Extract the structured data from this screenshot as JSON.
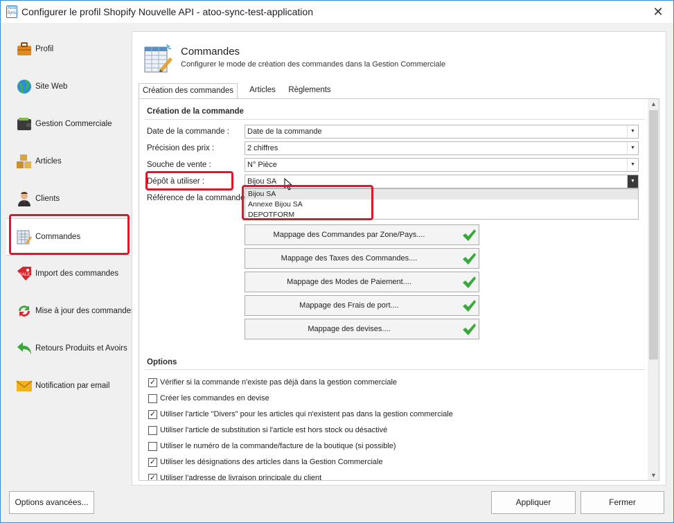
{
  "window": {
    "title": "Configurer le profil Shopify Nouvelle API - atoo-sync-test-application",
    "app_icon_text": "Atoo Sync",
    "close_glyph": "✕"
  },
  "sidebar": {
    "items": [
      {
        "label": "Profil",
        "icon": "briefcase-icon"
      },
      {
        "label": "Site Web",
        "icon": "globe-icon"
      },
      {
        "label": "Gestion Commerciale",
        "icon": "wallet-icon"
      },
      {
        "label": "Articles",
        "icon": "boxes-icon"
      },
      {
        "label": "Clients",
        "icon": "user-icon"
      },
      {
        "label": "Commandes",
        "icon": "order-sheet-icon"
      },
      {
        "label": "Import des commandes",
        "icon": "sale-tag-icon"
      },
      {
        "label": "Mise à jour des commandes",
        "icon": "refresh-arrows-icon"
      },
      {
        "label": "Retours Produits et Avoirs",
        "icon": "return-arrow-icon"
      },
      {
        "label": "Notification par email",
        "icon": "envelope-icon"
      }
    ],
    "active_index": 5
  },
  "header": {
    "title": "Commandes",
    "subtitle": "Configurer le mode de création des commandes dans la Gestion Commerciale"
  },
  "tabs": [
    {
      "label": "Création des commandes",
      "active": true
    },
    {
      "label": "Articles",
      "active": false
    },
    {
      "label": "Règlements",
      "active": false
    }
  ],
  "creation": {
    "section_title": "Création de la commande",
    "fields": [
      {
        "label": "Date de la commande :",
        "value": "Date de la commande"
      },
      {
        "label": "Précision des prix :",
        "value": "2 chiffres"
      },
      {
        "label": "Souche de vente :",
        "value": "N° Pièce"
      },
      {
        "label": "Dépôt à utiliser :",
        "value": "Bijou SA"
      },
      {
        "label": "Référence de la commande :",
        "value": ""
      }
    ],
    "dropdown_options": [
      "Bijou SA",
      "Annexe Bijou SA",
      "DEPOTFORM"
    ],
    "dropdown_selected": "Bijou SA"
  },
  "mappings": [
    {
      "label": "Mappage des Commandes par Zone/Pays...."
    },
    {
      "label": "Mappage des Taxes des Commandes...."
    },
    {
      "label": "Mappage des Modes de Paiement...."
    },
    {
      "label": "Mappage des Frais de port...."
    },
    {
      "label": "Mappage des devises...."
    }
  ],
  "options": {
    "section_title": "Options",
    "items": [
      {
        "label": "Vérifier si la commande n'existe pas déjà dans la gestion commerciale",
        "checked": true
      },
      {
        "label": "Créer les commandes en devise",
        "checked": false
      },
      {
        "label": "Utiliser l'article \"Divers\" pour les articles qui n'existent pas dans la gestion commerciale",
        "checked": true
      },
      {
        "label": "Utiliser l'article de substitution si l'article est hors stock ou désactivé",
        "checked": false
      },
      {
        "label": "Utiliser le numéro de la commande/facture de la boutique (si possible)",
        "checked": false
      },
      {
        "label": "Utiliser les désignations des articles dans la Gestion Commerciale",
        "checked": true
      },
      {
        "label": "Utiliser l'adresse de livraison principale du client",
        "checked": true
      }
    ]
  },
  "footer": {
    "advanced_label": "Options avancées...",
    "apply_label": "Appliquer",
    "close_label": "Fermer"
  },
  "colors": {
    "highlight": "#d7192b",
    "check_green": "#3aa83a",
    "title_border": "#3c8ad6"
  }
}
